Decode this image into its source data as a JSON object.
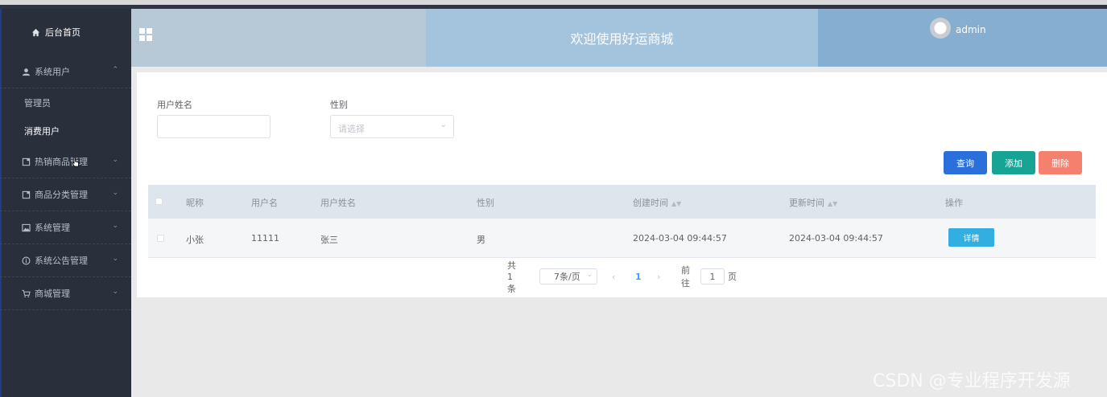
{
  "sidebar": {
    "home": "后台首页",
    "menus": [
      {
        "label": "系统用户",
        "icon": "user-icon"
      },
      {
        "label": "热销商品管理",
        "icon": "document-icon"
      },
      {
        "label": "商品分类管理",
        "icon": "document-icon"
      },
      {
        "label": "系统管理",
        "icon": "image-icon"
      },
      {
        "label": "系统公告管理",
        "icon": "info-icon"
      },
      {
        "label": "商城管理",
        "icon": "cart-icon"
      }
    ],
    "submenu": [
      "管理员",
      "消费用户"
    ]
  },
  "header": {
    "title": "欢迎使用好运商城",
    "user": "admin"
  },
  "search": {
    "name_label": "用户姓名",
    "name_value": "",
    "gender_label": "性别",
    "gender_placeholder": "请选择"
  },
  "buttons": {
    "query": "查询",
    "add": "添加",
    "delete": "删除"
  },
  "colors": {
    "query": "#2a6fdc",
    "add": "#17a495",
    "delete": "#f5806d",
    "detail": "#33aee0"
  },
  "table": {
    "columns": [
      "昵称",
      "用户名",
      "用户姓名",
      "性别",
      "创建时间",
      "更新时间",
      "操作"
    ],
    "rows": [
      {
        "nickname": "小张",
        "username": "11111",
        "realname": "张三",
        "gender": "男",
        "created": "2024-03-04 09:44:57",
        "updated": "2024-03-04 09:44:57",
        "action": "详情"
      }
    ]
  },
  "pagination": {
    "total": "共 1 条",
    "page_size": "7条/页",
    "current": "1",
    "goto_prefix": "前往",
    "goto_value": "1",
    "goto_suffix": "页"
  },
  "watermark": "CSDN @专业程序开发源"
}
